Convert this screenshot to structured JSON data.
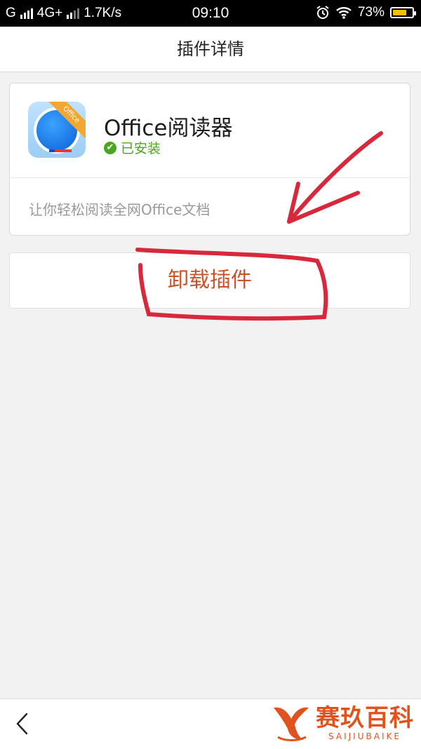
{
  "status_bar": {
    "carrier_left": "G",
    "network": "4G+",
    "speed": "1.7K/s",
    "time": "09:10",
    "battery": "73%",
    "battery_level": 0.73,
    "icons": [
      "signal-icon",
      "alarm-icon",
      "wifi-icon",
      "battery-icon"
    ]
  },
  "header": {
    "title": "插件详情"
  },
  "plugin": {
    "name": "Office阅读器",
    "icon_badge": "Office",
    "status": "已安装",
    "description": "让你轻松阅读全网Office文档"
  },
  "actions": {
    "uninstall_label": "卸载插件"
  },
  "bottom_bar": {
    "back_icon": "chevron-left-icon"
  },
  "watermark": {
    "title": "赛玖百科",
    "subtitle": "SAIJIUBAIKE"
  },
  "colors": {
    "accent_action": "#c9542b",
    "installed_green": "#4aa51f",
    "annotation_red": "#d8283c",
    "watermark_orange": "#e0531e"
  }
}
